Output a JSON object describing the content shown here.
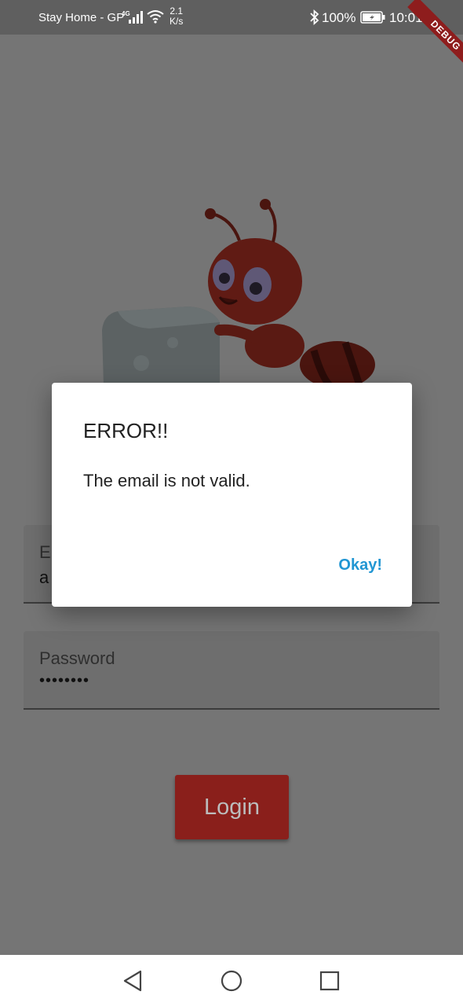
{
  "status_bar": {
    "carrier": "Stay Home - GP",
    "network_type": "4G",
    "speed": "2.1",
    "speed_unit": "K/s",
    "battery_percent": "100%",
    "time": "10:01",
    "icons": [
      "signal-icon",
      "wifi-icon",
      "bluetooth-icon",
      "battery-icon"
    ]
  },
  "debug_banner": "DEBUG",
  "login_form": {
    "email_label": "Email",
    "email_value": "a",
    "password_label": "Password",
    "password_value": "••••••••",
    "login_button": "Login"
  },
  "dialog": {
    "title": "ERROR!!",
    "message": "The email is not valid.",
    "action": "Okay!"
  },
  "nav_bar": {
    "icons": [
      "back-icon",
      "home-icon",
      "recents-icon"
    ]
  },
  "colors": {
    "scrim_background": "#757575",
    "primary_red": "#8a1f1b",
    "dialog_action": "#2196d3",
    "debug_banner": "#8e1d1d"
  }
}
